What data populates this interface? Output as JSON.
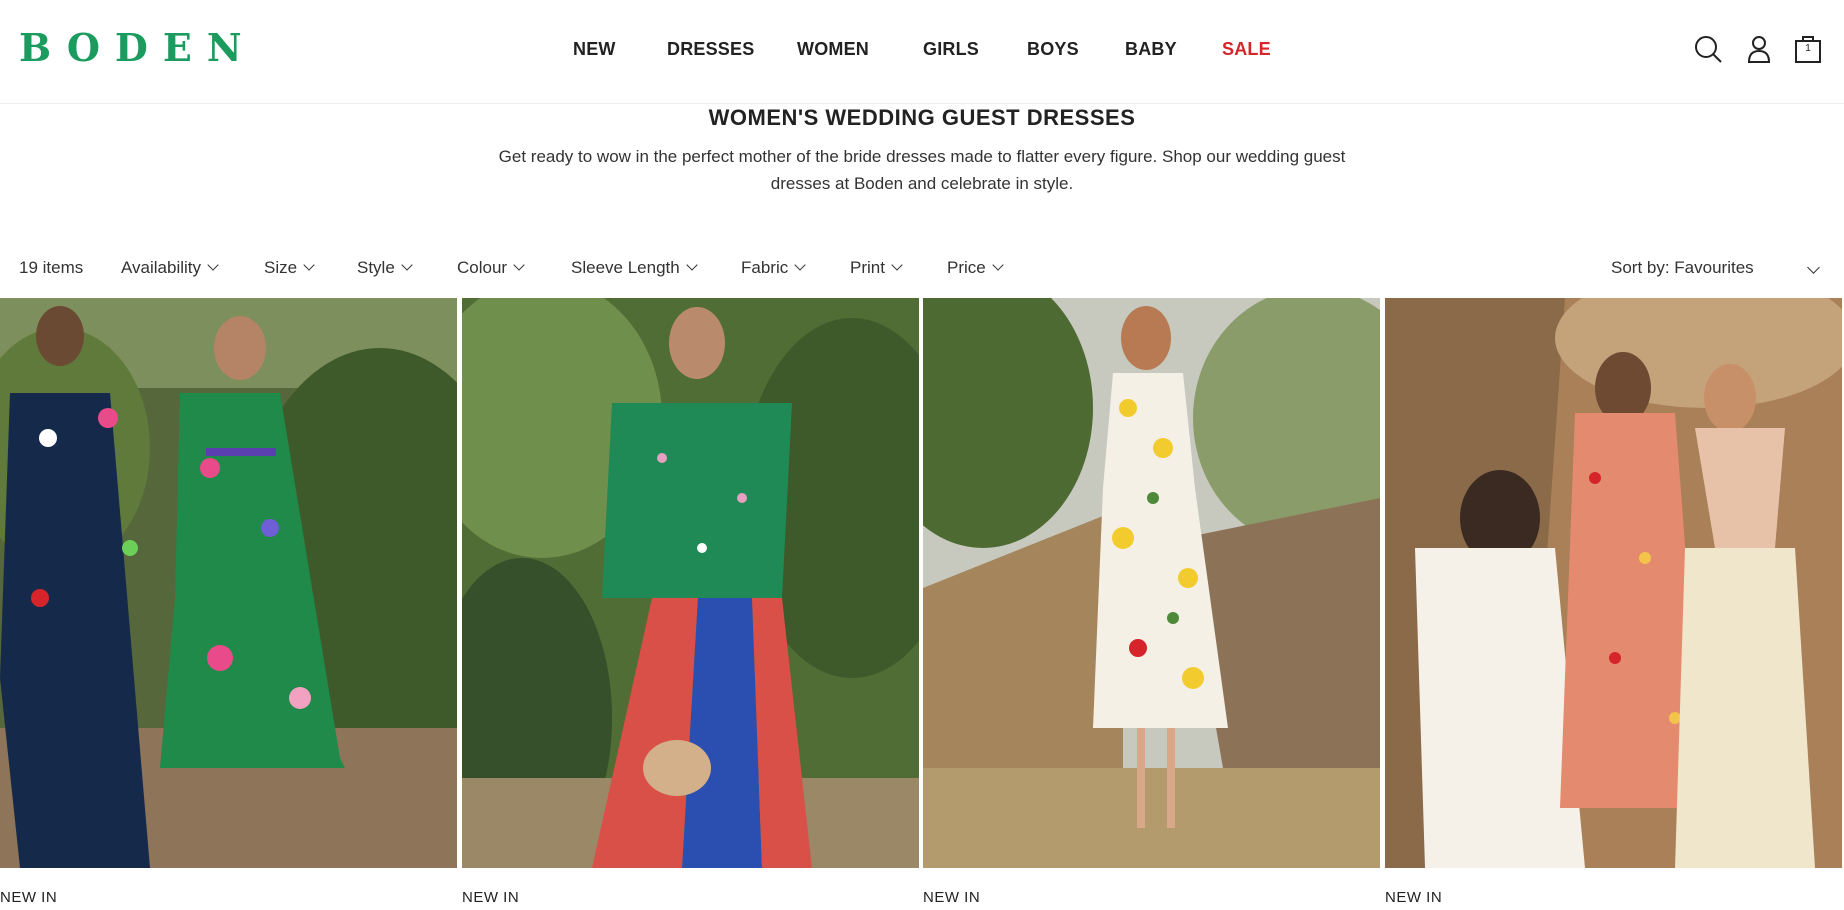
{
  "brand": {
    "logo_text": "BODEN",
    "color": "#1b9b5e"
  },
  "nav": {
    "items": [
      {
        "label": "NEW"
      },
      {
        "label": "DRESSES"
      },
      {
        "label": "WOMEN"
      },
      {
        "label": "GIRLS"
      },
      {
        "label": "BOYS"
      },
      {
        "label": "BABY"
      },
      {
        "label": "SALE",
        "color": "#d6242b"
      }
    ]
  },
  "header_icons": {
    "search": "search-icon",
    "account": "account-icon",
    "basket": "basket-icon",
    "basket_count": "1"
  },
  "page": {
    "title": "WOMEN'S WEDDING GUEST DRESSES",
    "description_line1": "Get ready to wow in the perfect mother of the bride dresses made to flatter every figure. Shop our wedding guest",
    "description_line2": "dresses at Boden and celebrate in style."
  },
  "filters": {
    "item_count": "19 items",
    "options": [
      {
        "label": "Availability"
      },
      {
        "label": "Size"
      },
      {
        "label": "Style"
      },
      {
        "label": "Colour"
      },
      {
        "label": "Sleeve Length"
      },
      {
        "label": "Fabric"
      },
      {
        "label": "Print"
      },
      {
        "label": "Price"
      }
    ],
    "sort_label": "Sort by: Favourites"
  },
  "products": [
    {
      "badge": "NEW IN"
    },
    {
      "badge": "NEW IN"
    },
    {
      "badge": "NEW IN"
    },
    {
      "badge": "NEW IN"
    }
  ]
}
